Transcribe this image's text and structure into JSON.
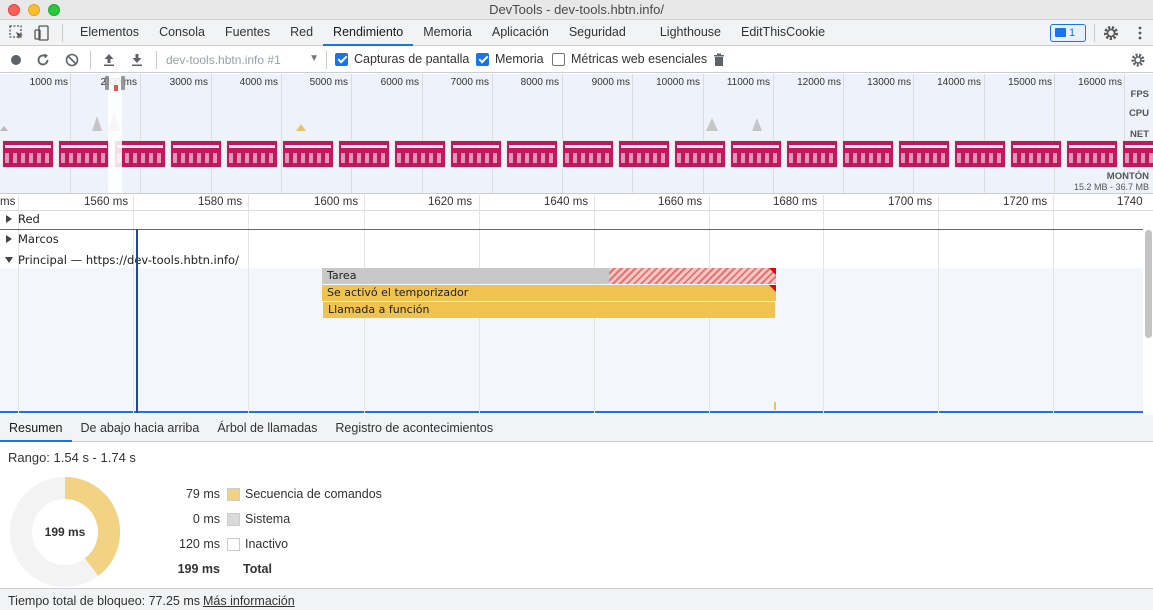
{
  "window": {
    "title": "DevTools - dev-tools.hbtn.info/"
  },
  "main_tabs": [
    {
      "label": "Elementos"
    },
    {
      "label": "Consola"
    },
    {
      "label": "Fuentes"
    },
    {
      "label": "Red"
    },
    {
      "label": "Rendimiento"
    },
    {
      "label": "Memoria"
    },
    {
      "label": "Aplicación"
    },
    {
      "label": "Seguridad"
    },
    {
      "label": "Lighthouse"
    },
    {
      "label": "EditThisCookie"
    }
  ],
  "issues_badge": {
    "count": "1"
  },
  "toolbar": {
    "profile_select": "dev-tools.hbtn.info #1",
    "screenshots_label": "Capturas de pantalla",
    "memory_label": "Memoria",
    "web_vitals_label": "Métricas web esenciales"
  },
  "overview": {
    "ticks": [
      "1000 ms",
      "2",
      "000 ms",
      "3000 ms",
      "4000 ms",
      "5000 ms",
      "6000 ms",
      "7000 ms",
      "8000 ms",
      "9000 ms",
      "10000 ms",
      "11000 ms",
      "12000 ms",
      "13000 ms",
      "14000 ms",
      "15000 ms",
      "16000 ms"
    ],
    "fps_label": "FPS",
    "cpu_label": "CPU",
    "net_label": "NET",
    "heap_label": "MONTÓN",
    "heap_range": "15.2 MB - 36.7 MB"
  },
  "ruler": {
    "ticks": [
      "ms",
      "1560 ms",
      "1580 ms",
      "1600 ms",
      "1620 ms",
      "1640 ms",
      "1660 ms",
      "1680 ms",
      "1700 ms",
      "1720 ms",
      "1740"
    ]
  },
  "tracks": {
    "network": "Red",
    "frames": "Marcos",
    "main": "Principal — https://dev-tools.hbtn.info/"
  },
  "events": {
    "task": "Tarea",
    "timer": "Se activó el temporizador",
    "function_call": "Llamada a función"
  },
  "bottom_tabs": [
    {
      "label": "Resumen"
    },
    {
      "label": "De abajo hacia arriba"
    },
    {
      "label": "Árbol de llamadas"
    },
    {
      "label": "Registro de acontecimientos"
    }
  ],
  "summary": {
    "range": "Rango: 1.54 s - 1.74 s",
    "total_center": "199 ms",
    "rows": [
      {
        "value": "79 ms",
        "name": "Secuencia de comandos",
        "color": "#f2d283",
        "ms": 79
      },
      {
        "value": "0 ms",
        "name": "Sistema",
        "color": "#dadada",
        "ms": 0
      },
      {
        "value": "120 ms",
        "name": "Inactivo",
        "color": "#ffffff",
        "ms": 120
      }
    ],
    "total_value": "199 ms",
    "total_label": "Total"
  },
  "footer": {
    "blocking": "Tiempo total de bloqueo: 77.25 ms",
    "link": "Más información"
  }
}
